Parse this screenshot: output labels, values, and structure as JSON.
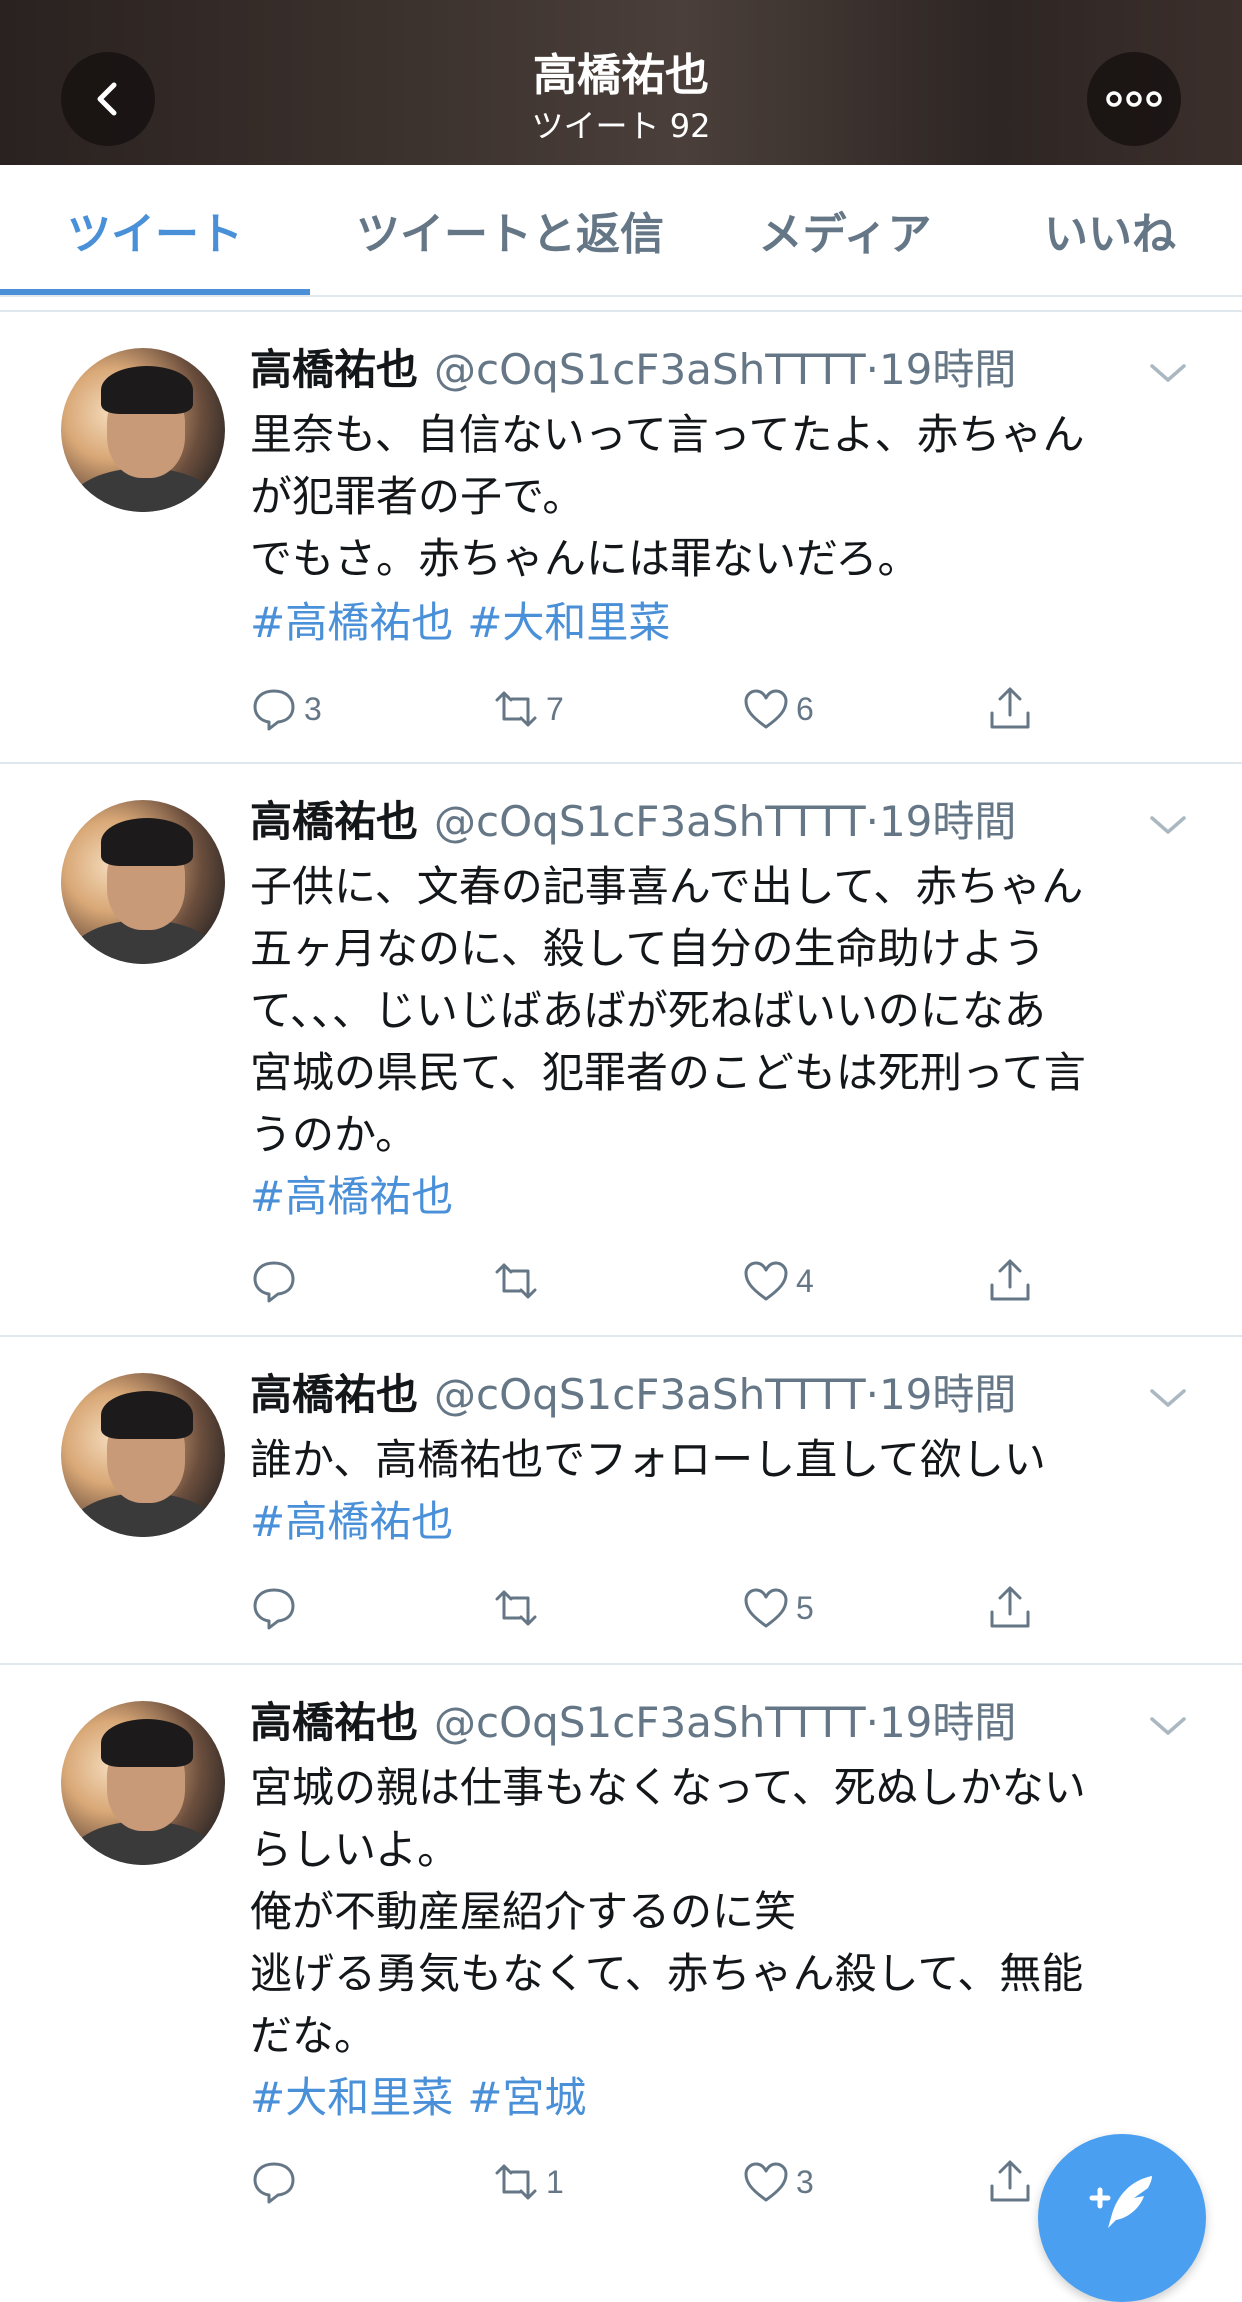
{
  "header": {
    "title": "高橋祐也",
    "subtitle": "ツイート 92",
    "back_icon": "chevron-left-icon",
    "more_icon": "more-dots-icon"
  },
  "tabs": [
    {
      "label": "ツイート",
      "active": true
    },
    {
      "label": "ツイートと返信",
      "active": false
    },
    {
      "label": "メディア",
      "active": false
    },
    {
      "label": "いいね",
      "active": false
    }
  ],
  "colors": {
    "accent": "#4a90d9",
    "muted": "#657786",
    "text": "#14171a",
    "fab": "#4a9ff0"
  },
  "tweets": [
    {
      "name": "高橋祐也",
      "handle": "@cOqS1cF3aShTTTT",
      "time": "·19時間",
      "text": "里奈も、自信ないって言ってたよ、赤ちゃん\nが犯罪者の子で。\nでもさ。赤ちゃんには罪ないだろ。",
      "hashtags": [
        "#高橋祐也",
        "#大和里菜"
      ],
      "replies": "3",
      "retweets": "7",
      "likes": "6"
    },
    {
      "name": "高橋祐也",
      "handle": "@cOqS1cF3aShTTTT",
      "time": "·19時間",
      "text": "子供に、文春の記事喜んで出して、赤ちゃん\n五ヶ月なのに、殺して自分の生命助けよう\nて、、、じいじばあばが死ねばいいのになあ\n宮城の県民て、犯罪者のこどもは死刑って言\nうのか。",
      "hashtags": [
        "#高橋祐也"
      ],
      "replies": "",
      "retweets": "",
      "likes": "4"
    },
    {
      "name": "高橋祐也",
      "handle": "@cOqS1cF3aShTTTT",
      "time": "·19時間",
      "text": "誰か、高橋祐也でフォローし直して欲しい",
      "hashtags": [
        "#高橋祐也"
      ],
      "replies": "",
      "retweets": "",
      "likes": "5"
    },
    {
      "name": "高橋祐也",
      "handle": "@cOqS1cF3aShTTTT",
      "time": "·19時間",
      "text": "宮城の親は仕事もなくなって、死ぬしかない\nらしいよ。\n俺が不動産屋紹介するのに笑\n逃げる勇気もなくて、赤ちゃん殺して、無能\nだな。",
      "hashtags": [
        "#大和里菜",
        "#宮城"
      ],
      "replies": "",
      "retweets": "1",
      "likes": "3"
    }
  ],
  "fab": {
    "icon": "compose-tweet-icon"
  }
}
